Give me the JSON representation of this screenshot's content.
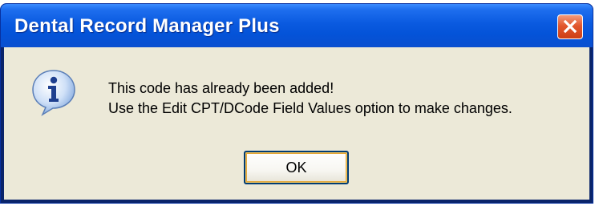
{
  "window": {
    "title": "Dental Record Manager Plus"
  },
  "dialog": {
    "icon": "info-icon",
    "message_line1": "This code has already been added!",
    "message_line2": "Use the Edit CPT/DCode Field Values option to make changes.",
    "ok_label": "OK"
  },
  "colors": {
    "titlebar": "#0453d8",
    "client_background": "#ece9d8",
    "close_button": "#e2572e",
    "button_border": "#003c74"
  }
}
